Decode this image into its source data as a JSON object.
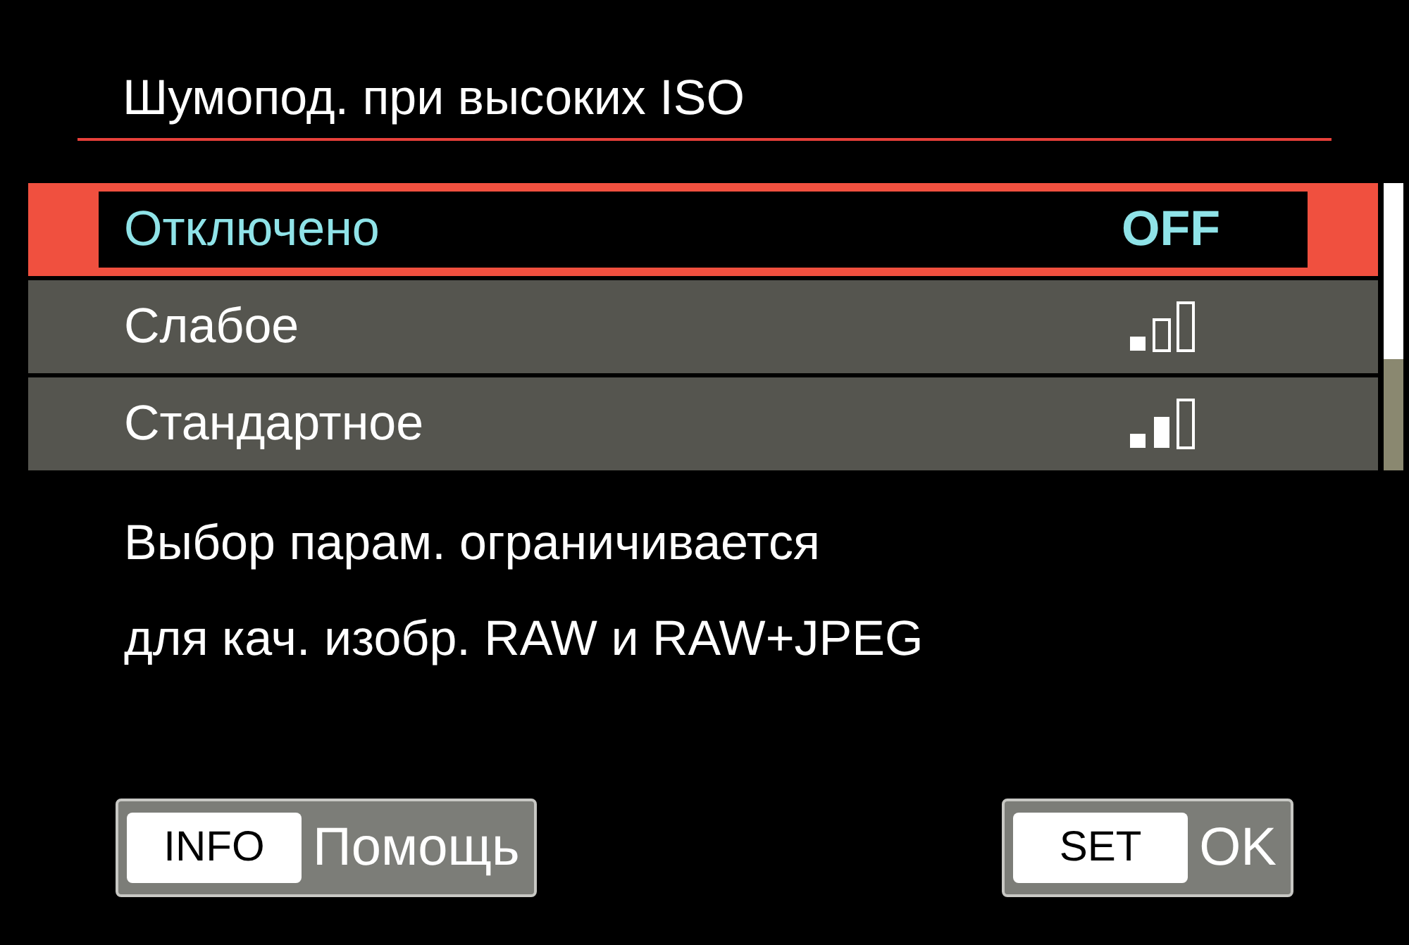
{
  "title": "Шумопод. при высоких ISO",
  "options": [
    {
      "label": "Отключено",
      "selected": true,
      "kind": "text",
      "value": "OFF"
    },
    {
      "label": "Слабое",
      "selected": false,
      "kind": "bars",
      "level": 0.33
    },
    {
      "label": "Стандартное",
      "selected": false,
      "kind": "bars",
      "level": 0.67
    }
  ],
  "description": [
    "Выбор парам. ограничивается",
    "для кач. изобр. RAW и RAW+JPEG"
  ],
  "buttons": [
    {
      "key": "INFO",
      "label": "Помощь"
    },
    {
      "key": "SET",
      "label": "OK"
    }
  ]
}
